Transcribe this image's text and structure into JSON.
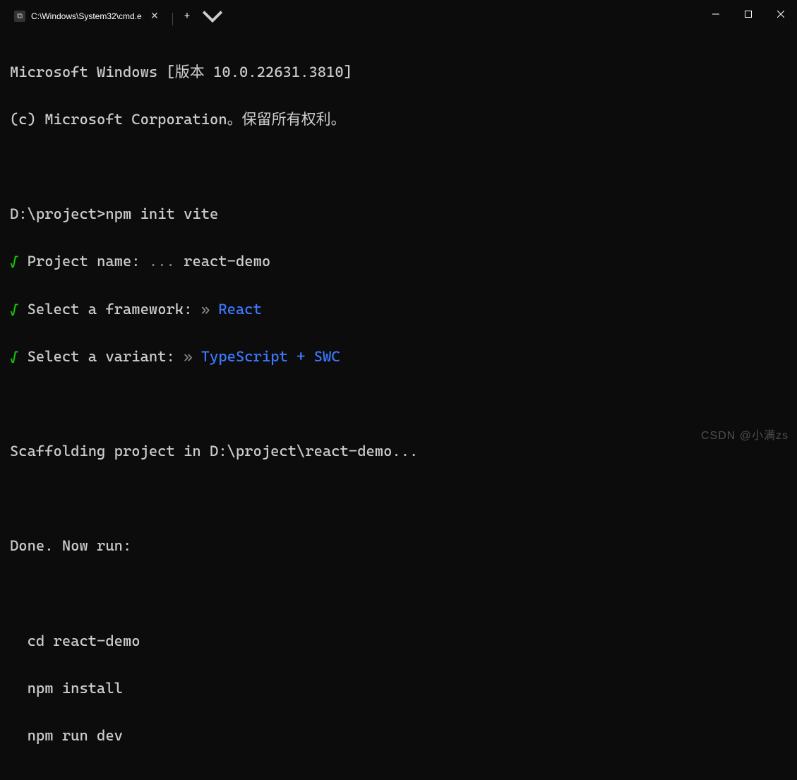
{
  "titlebar": {
    "tab": {
      "title": "C:\\Windows\\System32\\cmd.e",
      "icon_glyph": "⧉"
    }
  },
  "terminal": {
    "banner_line1": "Microsoft Windows [版本 10.0.22631.3810]",
    "banner_line2": "(c) Microsoft Corporation。保留所有权利。",
    "prompt": "D:\\project>",
    "command": "npm init vite",
    "prompts": [
      {
        "check": "√",
        "label": "Project name:",
        "sep": "...",
        "value": "react-demo",
        "value_blue": false
      },
      {
        "check": "√",
        "label": "Select a framework:",
        "sep": "»",
        "value": "React",
        "value_blue": true
      },
      {
        "check": "√",
        "label": "Select a variant:",
        "sep": "»",
        "value": "TypeScript + SWC",
        "value_blue": true
      }
    ],
    "scaffold": "Scaffolding project in D:\\project\\react-demo...",
    "done": "Done. Now run:",
    "run_cmds": [
      "cd react-demo",
      "npm install",
      "npm run dev"
    ]
  },
  "watermark": "CSDN @小满zs"
}
